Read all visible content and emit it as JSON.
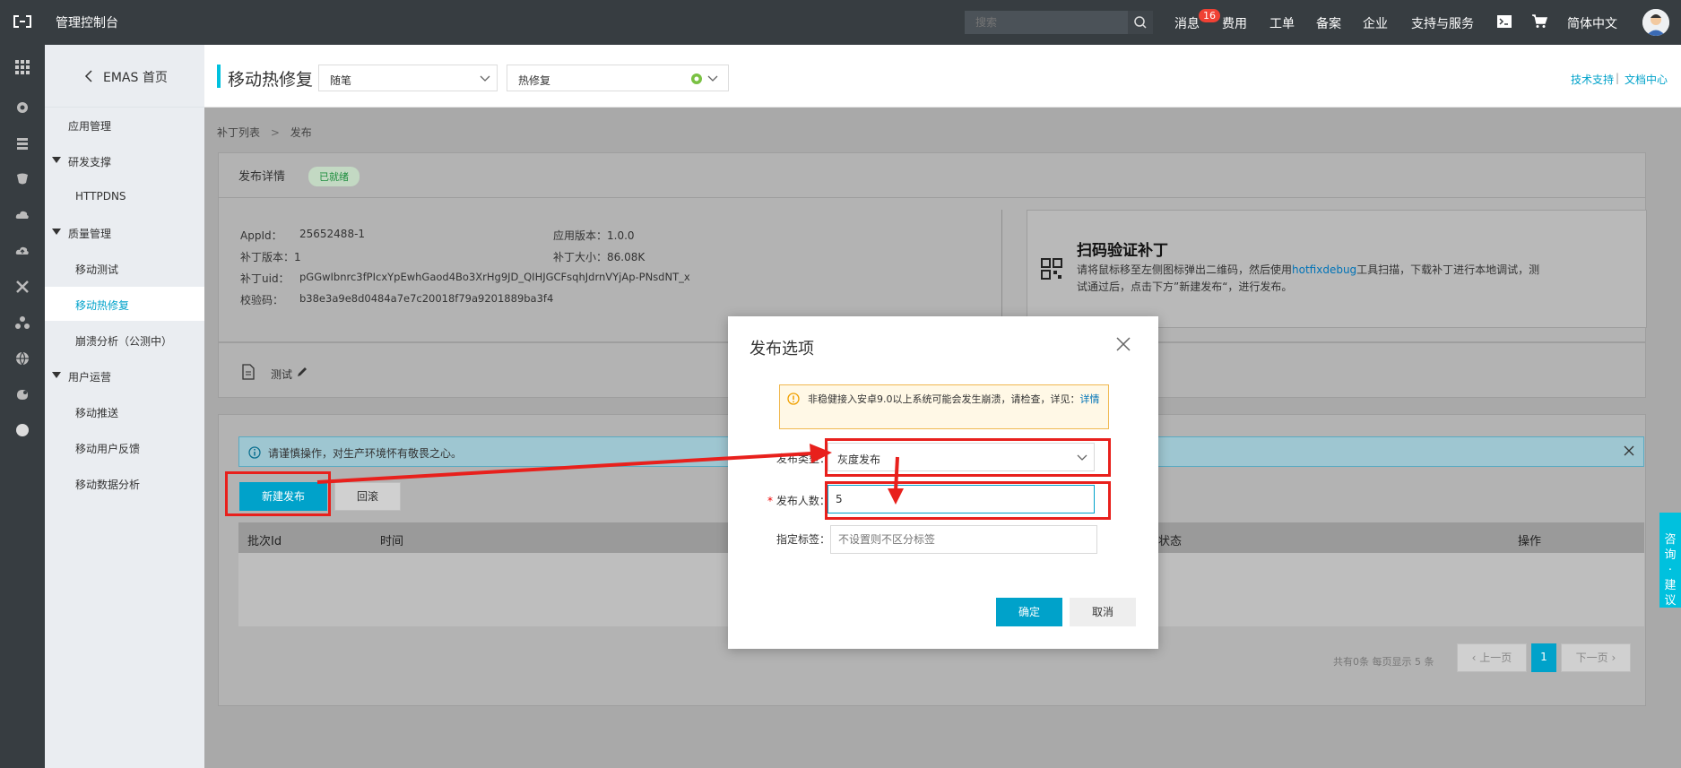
{
  "topbar": {
    "console_title": "管理控制台",
    "search_placeholder": "搜索",
    "nav": [
      "消息",
      "费用",
      "工单",
      "备案",
      "企业",
      "支持与服务",
      "简体中文"
    ],
    "message_count": "16"
  },
  "sidebar": {
    "home": "EMAS 首页",
    "items": [
      {
        "label": "应用管理",
        "type": "item"
      },
      {
        "label": "研发支撑",
        "type": "group"
      },
      {
        "label": "HTTPDNS",
        "type": "sub"
      },
      {
        "label": "质量管理",
        "type": "group"
      },
      {
        "label": "移动测试",
        "type": "sub"
      },
      {
        "label": "移动热修复",
        "type": "sub-active"
      },
      {
        "label": "崩溃分析（公测中）",
        "type": "sub"
      },
      {
        "label": "用户运营",
        "type": "group"
      },
      {
        "label": "移动推送",
        "type": "sub"
      },
      {
        "label": "移动用户反馈",
        "type": "sub"
      },
      {
        "label": "移动数据分析",
        "type": "sub"
      }
    ]
  },
  "header": {
    "title": "移动热修复",
    "app_select": "随笔",
    "product_select": "热修复",
    "link_support": "技术支持",
    "link_sep": "|",
    "link_docs": "文档中心"
  },
  "breadcrumb": {
    "parent": "补丁列表",
    "sep": ">",
    "current": "发布"
  },
  "detail": {
    "title": "发布详情",
    "status": "已就绪",
    "appid_label": "AppId：",
    "appid": "25652488-1",
    "app_version": "应用版本：1.0.0",
    "patch_version": "补丁版本：1",
    "patch_size": "补丁大小：86.08K",
    "patch_uid_label": "补丁uid：",
    "patch_uid": "pGGwIbnrc3fPIcxYpEwhGaod4Bo3XrHg9JD_QIHJGCFsqhJdrnVYjAp-PNsdNT_x",
    "checksum_label": "校验码：",
    "checksum": "b38e3a9e8d0484a7e7c20018f79a9201889ba3f4",
    "note": "测试"
  },
  "qr": {
    "title": "扫码验证补丁",
    "desc_1": "请将鼠标移至左侧图标弹出二维码，然后使用",
    "desc_link": "hotfixdebug",
    "desc_2": "工具扫描，下载补丁进行本地调试，测试通过后，点击下方”新建发布“，进行发布。"
  },
  "notice": "请谨慎操作，对生产环境怀有敬畏之心。",
  "actions": {
    "new_release": "新建发布",
    "rollback": "回滚"
  },
  "table": {
    "columns": [
      "批次Id",
      "时间",
      "状态",
      "操作"
    ]
  },
  "pager": {
    "summary": "共有0条  每页显示 5 条",
    "prev": "上一页",
    "page": "1",
    "next": "下一页"
  },
  "float_tab": "咨询·建议",
  "modal": {
    "title": "发布选项",
    "warning": "非稳健接入安卓9.0以上系统可能会发生崩溃，请检查，详见：",
    "warning_link": "详情",
    "type_label": "发布类型：",
    "type_value": "灰度发布",
    "count_label": "发布人数：",
    "count_value": "5",
    "tags_label": "指定标签：",
    "tags_placeholder": "不设置则不区分标签",
    "confirm": "确定",
    "cancel": "取消"
  },
  "colors": {
    "accent": "#00a2ca",
    "annotation": "#e8201c",
    "topbar": "#373d41"
  }
}
